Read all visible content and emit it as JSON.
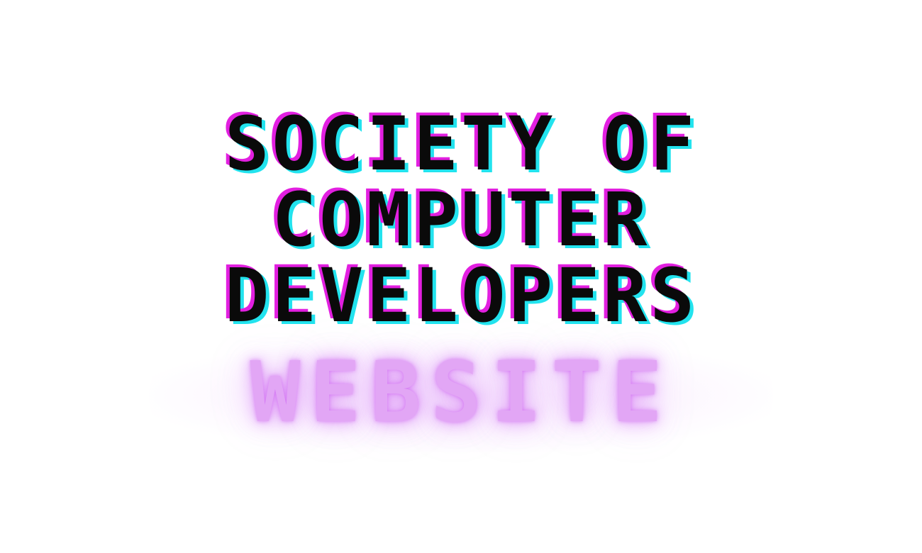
{
  "title": {
    "lines": [
      "SOCIETY OF",
      "COMPUTER",
      "DEVELOPERS"
    ]
  },
  "subtitle": "WEBSITE",
  "colors": {
    "background": "#ffffff",
    "title_text": "#0a0a0a",
    "title_shadow_magenta": "#e21fe0",
    "title_shadow_cyan": "#22e3ee",
    "subtitle_text": "#e2a6f5",
    "subtitle_glow": "#c850f0"
  }
}
